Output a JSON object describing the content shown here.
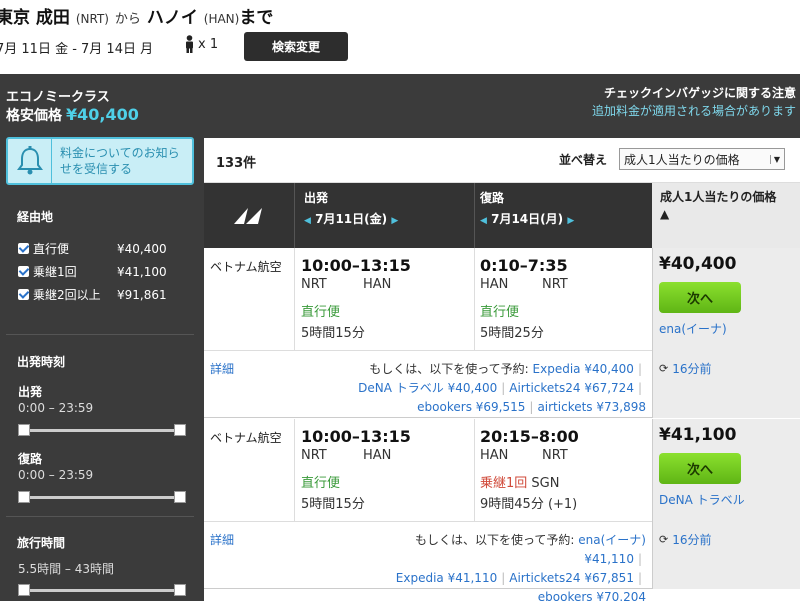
{
  "header": {
    "origin": "東京 成田",
    "origin_code": "(NRT)",
    "from_particle": "から",
    "destination": "ハノイ",
    "destination_code": "(HAN)",
    "to_particle": "まで",
    "dates": "7月 11日 金 - 7月 14日 月",
    "travelers": "x 1",
    "search_change_label": "検索変更"
  },
  "panel": {
    "cabin_class": "エコノミークラス",
    "cheapest_label": "格安価格",
    "cheapest_price": "¥40,400",
    "baggage_title": "チェックインバゲッジに関する注意",
    "baggage_sub": "追加料金が適用される場合があります",
    "alert_label": "料金についてのお知らせを受信する"
  },
  "sidebar": {
    "stops_title": "経由地",
    "stops": [
      {
        "label": "直行便",
        "price": "¥40,400"
      },
      {
        "label": "乗継1回",
        "price": "¥41,100"
      },
      {
        "label": "乗継2回以上",
        "price": "¥91,861"
      }
    ],
    "departure_title": "出発時刻",
    "depart_label": "出発",
    "depart_range": "0:00 – 23:59",
    "return_label": "復路",
    "return_range": "0:00 – 23:59",
    "duration_title": "旅行時間",
    "duration_range": "5.5時間 – 43時間"
  },
  "results": {
    "count": "133件",
    "sort_label": "並べ替え",
    "sort_value": "成人1人当たりの価格",
    "outbound_head": "出発",
    "outbound_date": "7月11日(金)",
    "return_head": "復路",
    "return_date": "7月14日(月)",
    "price_head": "成人1人当たりの価格"
  },
  "flights": [
    {
      "airline": "ベトナム航空",
      "out_times": "10:00–13:15",
      "out_from": "NRT",
      "out_to": "HAN",
      "out_stops": "直行便",
      "out_duration": "5時間15分",
      "ret_times": "0:10–7:35",
      "ret_from": "HAN",
      "ret_to": "NRT",
      "ret_stops": "直行便",
      "ret_via": "",
      "ret_duration": "5時間25分",
      "detail": "詳細",
      "alt_intro": "もしくは、以下を使って予約:",
      "alts": [
        "Expedia ¥40,400",
        "DeNA トラベル ¥40,400",
        "Airtickets24 ¥67,724",
        "ebookers ¥69,515",
        "airtickets ¥73,898"
      ],
      "price": "¥40,400",
      "next": "次へ",
      "provider": "ena(イーナ)",
      "updated": "16分前"
    },
    {
      "airline": "ベトナム航空",
      "out_times": "10:00–13:15",
      "out_from": "NRT",
      "out_to": "HAN",
      "out_stops": "直行便",
      "out_duration": "5時間15分",
      "ret_times": "20:15–8:00",
      "ret_from": "HAN",
      "ret_to": "NRT",
      "ret_stops": "乗継1回",
      "ret_via": "SGN",
      "ret_duration": "9時間45分 (+1)",
      "detail": "詳細",
      "alt_intro": "もしくは、以下を使って予約:",
      "alts": [
        "ena(イーナ) ¥41,110",
        "Expedia ¥41,110",
        "Airtickets24 ¥67,851",
        "ebookers ¥70,204"
      ],
      "price": "¥41,100",
      "next": "次へ",
      "provider": "DeNA トラベル",
      "updated": "16分前"
    }
  ],
  "colors": {
    "accent": "#4fd0e8",
    "panel": "#3b3b3b",
    "next_button": "#6cc61e",
    "link": "#2a72c9",
    "direct": "#3a9a3a",
    "stops": "#d04a3a"
  }
}
